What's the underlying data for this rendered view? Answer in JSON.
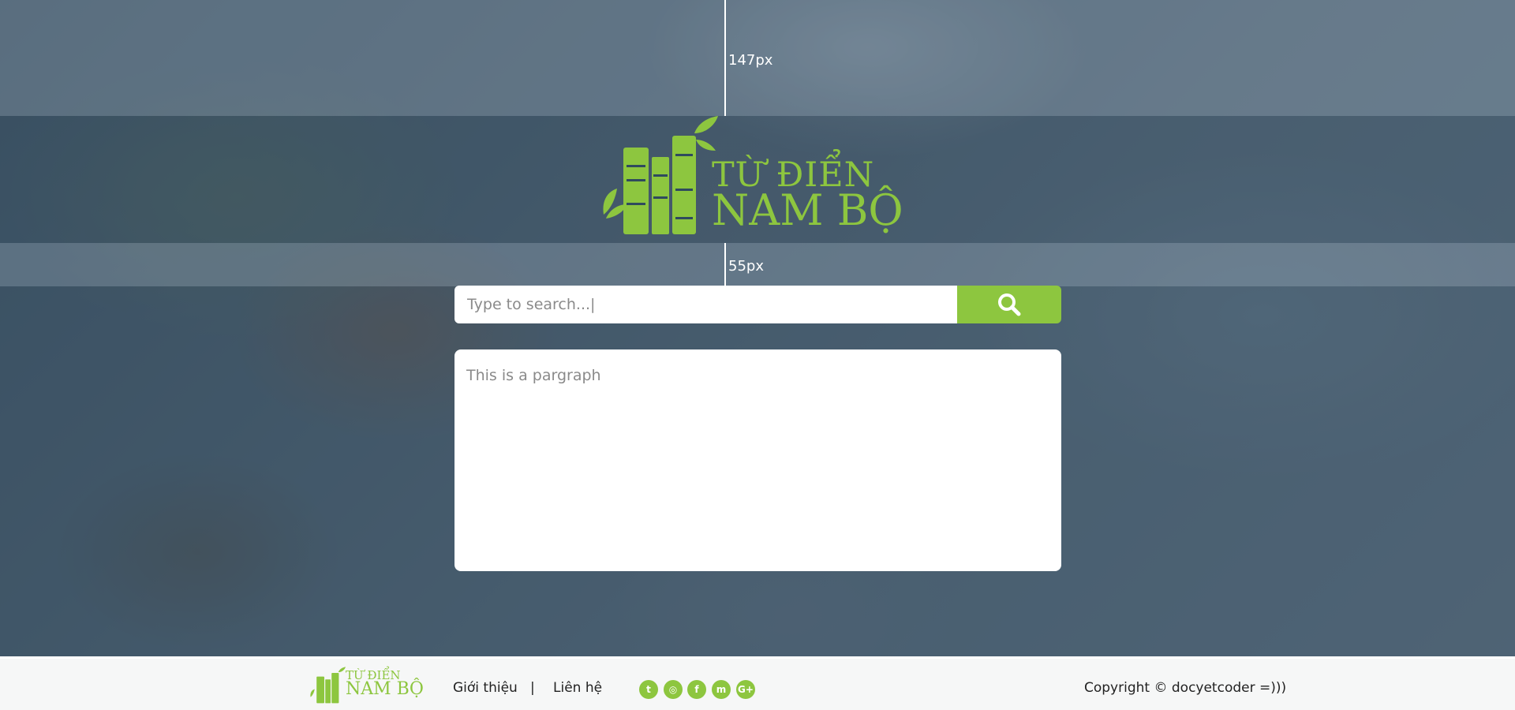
{
  "guides": {
    "top_label": "147px",
    "bottom_label": "55px"
  },
  "logo": {
    "line1": "TỪ ĐIỂN",
    "line2": "NAM BỘ"
  },
  "search": {
    "placeholder": "Type to search...|",
    "button_icon": "search-icon"
  },
  "paragraph": {
    "text": "This is a pargraph"
  },
  "footer": {
    "logo_line1": "TỪ ĐIỂN",
    "logo_line2": "NAM BỘ",
    "links": [
      {
        "label": "Giới thiệu"
      },
      {
        "label": "Liên hệ"
      }
    ],
    "separator": "|",
    "social": [
      {
        "icon": "twitter-icon",
        "glyph": "t"
      },
      {
        "icon": "instagram-icon",
        "glyph": "◎"
      },
      {
        "icon": "facebook-icon",
        "glyph": "f"
      },
      {
        "icon": "messenger-icon",
        "glyph": "m"
      },
      {
        "icon": "google-plus-icon",
        "glyph": "G+"
      }
    ],
    "copyright": "Copyright © docyetcoder =)))"
  },
  "colors": {
    "accent": "#8dc63f",
    "overlay": "#1e3750"
  }
}
